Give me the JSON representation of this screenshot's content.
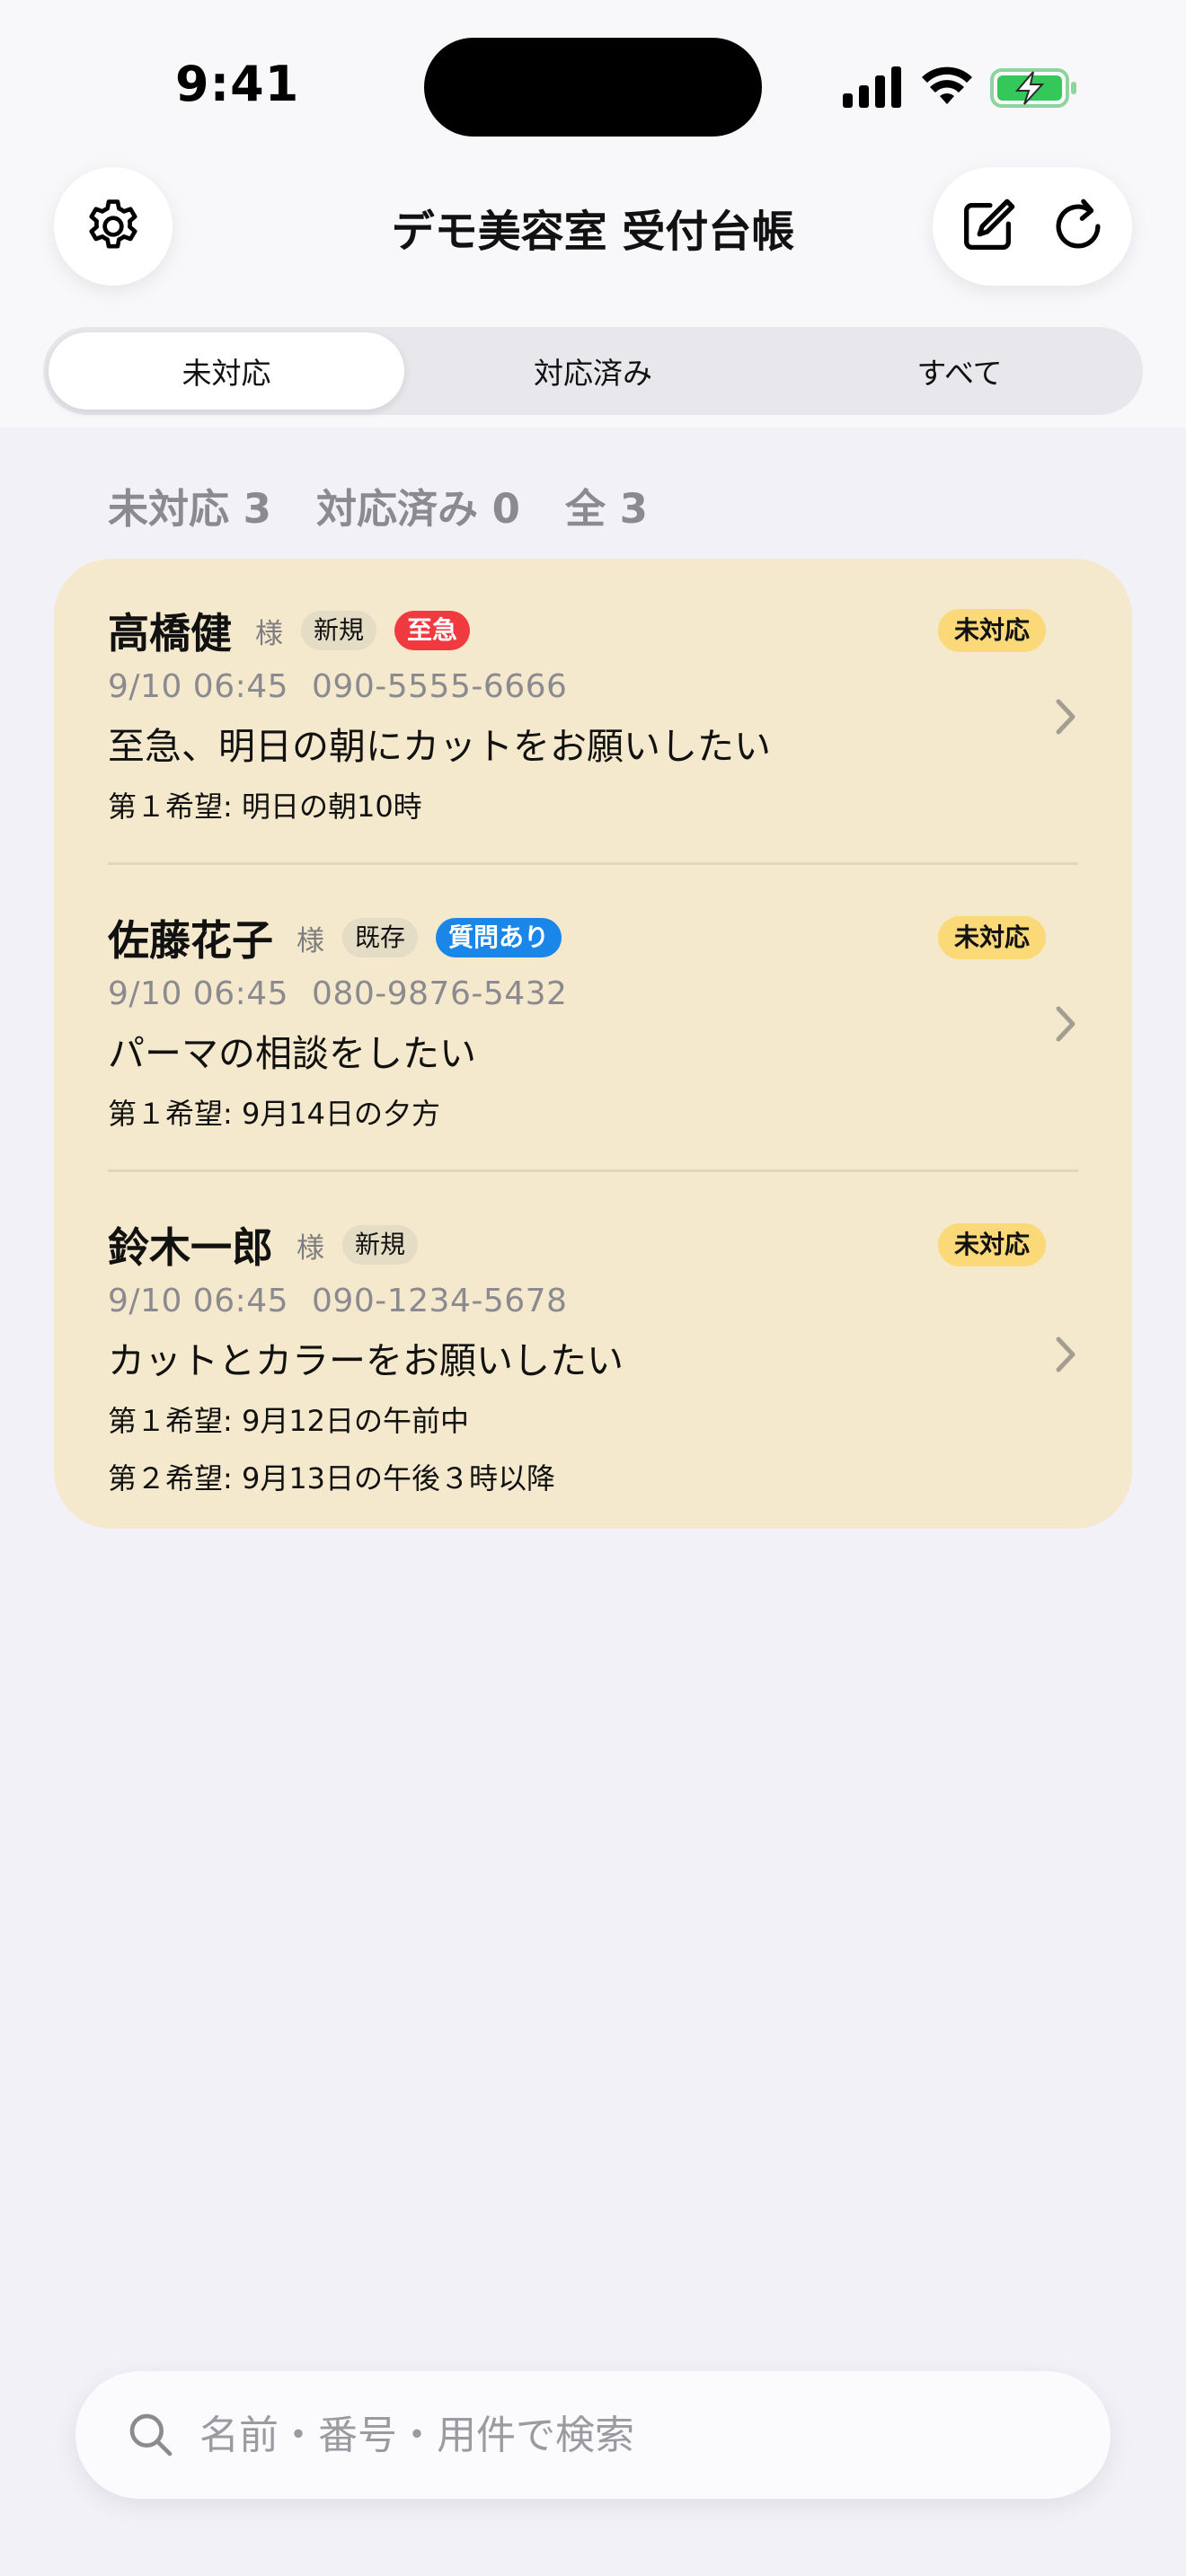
{
  "status_bar": {
    "time": "9:41"
  },
  "header": {
    "title": "デモ美容室 受付台帳",
    "icons": [
      "gear-icon",
      "compose-icon",
      "refresh-icon"
    ]
  },
  "tabs": [
    {
      "label": "未対応",
      "active": true
    },
    {
      "label": "対応済み",
      "active": false
    },
    {
      "label": "すべて",
      "active": false
    }
  ],
  "counts": {
    "pending": "未対応 3",
    "done": "対応済み 0",
    "all": "全 3"
  },
  "reservations": [
    {
      "name": "高橋健",
      "honorific": "様",
      "tags": [
        {
          "label": "新規",
          "style": "gray"
        },
        {
          "label": "至急",
          "style": "red"
        }
      ],
      "status": "未対応",
      "datetime": "9/10 06:45",
      "phone": "090-5555-6666",
      "message": "至急、明日の朝にカットをお願いしたい",
      "preferences": [
        "第１希望: 明日の朝10時"
      ]
    },
    {
      "name": "佐藤花子",
      "honorific": "様",
      "tags": [
        {
          "label": "既存",
          "style": "gray"
        },
        {
          "label": "質問あり",
          "style": "blue"
        }
      ],
      "status": "未対応",
      "datetime": "9/10 06:45",
      "phone": "080-9876-5432",
      "message": "パーマの相談をしたい",
      "preferences": [
        "第１希望: 9月14日の夕方"
      ]
    },
    {
      "name": "鈴木一郎",
      "honorific": "様",
      "tags": [
        {
          "label": "新規",
          "style": "gray"
        }
      ],
      "status": "未対応",
      "datetime": "9/10 06:45",
      "phone": "090-1234-5678",
      "message": "カットとカラーをお願いしたい",
      "preferences": [
        "第１希望: 9月12日の午前中",
        "第２希望: 9月13日の午後３時以降"
      ]
    }
  ],
  "search": {
    "placeholder": "名前・番号・用件で検索",
    "value": ""
  },
  "colors": {
    "card_bg": "#f5e9cd",
    "status_badge": "#fbd978",
    "urgent_tag": "#f03a3f",
    "question_tag": "#1a86e8",
    "battery_green": "#34c759"
  }
}
